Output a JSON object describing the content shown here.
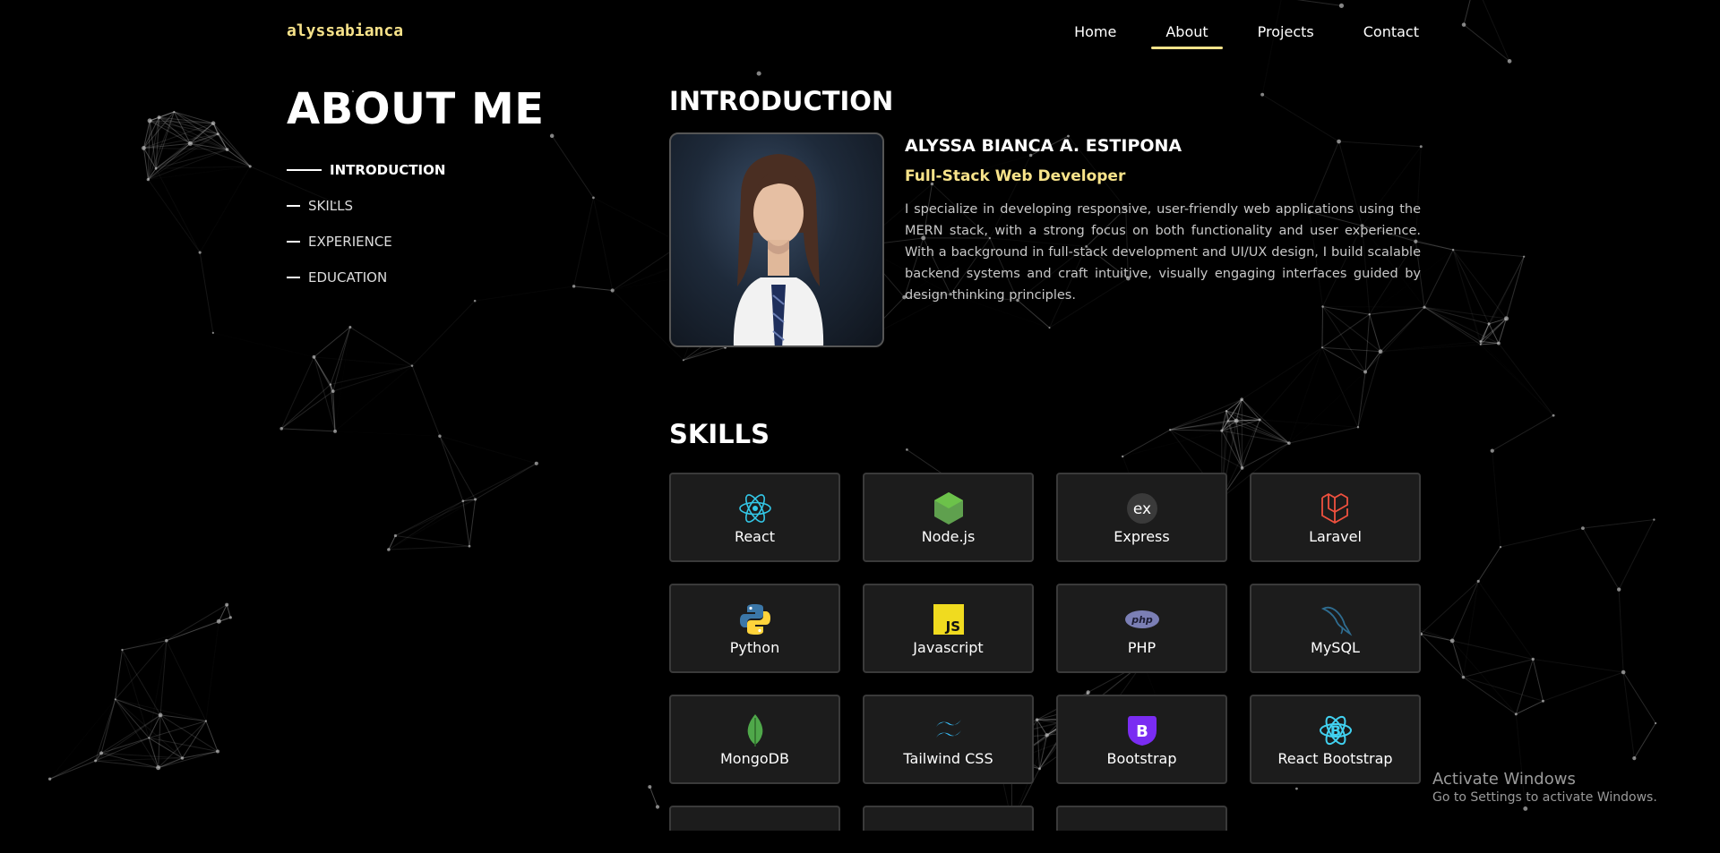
{
  "brand": "alyssabianca",
  "nav": {
    "items": [
      {
        "label": "Home"
      },
      {
        "label": "About"
      },
      {
        "label": "Projects"
      },
      {
        "label": "Contact"
      }
    ],
    "active": "About"
  },
  "about": {
    "title": "ABOUT ME",
    "toc": [
      {
        "label": "INTRODUCTION",
        "active": true
      },
      {
        "label": "SKILLS"
      },
      {
        "label": "EXPERIENCE"
      },
      {
        "label": "EDUCATION"
      }
    ]
  },
  "introduction": {
    "heading": "INTRODUCTION",
    "name": "ALYSSA BIANCA A. ESTIPONA",
    "role": "Full-Stack Web Developer",
    "bio": "I specialize in developing responsive, user-friendly web applications using the MERN stack, with a strong focus on both functionality and user experience. With a background in full-stack development and UI/UX design, I build scalable backend systems and craft intuitive, visually engaging interfaces guided by design thinking principles."
  },
  "skills": {
    "heading": "SKILLS",
    "items": [
      {
        "label": "React",
        "icon": "react-icon"
      },
      {
        "label": "Node.js",
        "icon": "nodejs-icon"
      },
      {
        "label": "Express",
        "icon": "express-icon"
      },
      {
        "label": "Laravel",
        "icon": "laravel-icon"
      },
      {
        "label": "Python",
        "icon": "python-icon"
      },
      {
        "label": "Javascript",
        "icon": "javascript-icon"
      },
      {
        "label": "PHP",
        "icon": "php-icon"
      },
      {
        "label": "MySQL",
        "icon": "mysql-icon"
      },
      {
        "label": "MongoDB",
        "icon": "mongodb-icon"
      },
      {
        "label": "Tailwind CSS",
        "icon": "tailwind-icon"
      },
      {
        "label": "Bootstrap",
        "icon": "bootstrap-icon"
      },
      {
        "label": "React Bootstrap",
        "icon": "react-bootstrap-icon"
      },
      {
        "label": "",
        "icon": "figma-icon"
      },
      {
        "label": "",
        "icon": "docker-icon"
      },
      {
        "label": "",
        "icon": "git-icon"
      }
    ]
  },
  "watermark": {
    "title": "Activate Windows",
    "subtitle": "Go to Settings to activate Windows."
  },
  "colors": {
    "accent": "#f8e38a",
    "background": "#000000",
    "card": "#1c1c1c",
    "card_border": "#3a3a3a"
  }
}
